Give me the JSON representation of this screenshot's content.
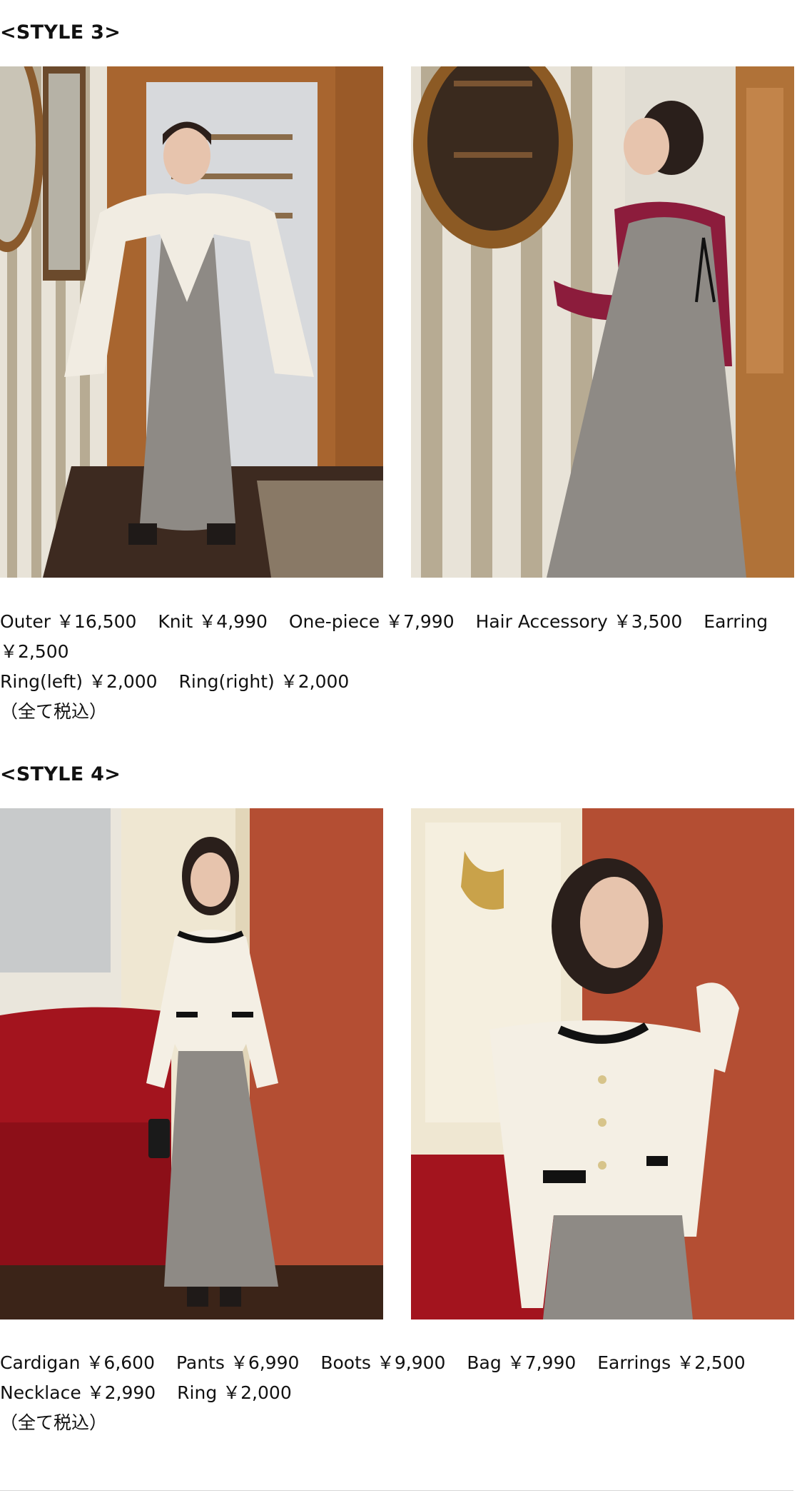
{
  "style3": {
    "title": "<STYLE 3>",
    "items": [
      "Outer ￥16,500",
      "Knit ￥4,990",
      "One-piece ￥7,990",
      "Hair Accessory ￥3,500",
      "Earring ￥2,500"
    ],
    "items_line2": [
      "Ring(left) ￥2,000",
      "Ring(right) ￥2,000"
    ],
    "tax_note": "（全て税込）"
  },
  "style4": {
    "title": "<STYLE 4>",
    "items": [
      "Cardigan ￥6,600",
      "Pants ￥6,990",
      "Boots ￥9,900",
      "Bag ￥7,990",
      "Earrings ￥2,500"
    ],
    "items_line2": [
      "Necklace ￥2,990",
      "Ring ￥2,000"
    ],
    "tax_note": "（全て税込）"
  },
  "colors": {
    "wood": "#a8652f",
    "stripe_light": "#e8e3d8",
    "stripe_dark": "#b7ab93",
    "knit_red": "#8c1c3c",
    "tweed_gray": "#8e8a85",
    "fur_white": "#f1ece2",
    "wall_orange": "#b44e33",
    "sofa_red": "#a3141e",
    "cream": "#f4efe4"
  }
}
